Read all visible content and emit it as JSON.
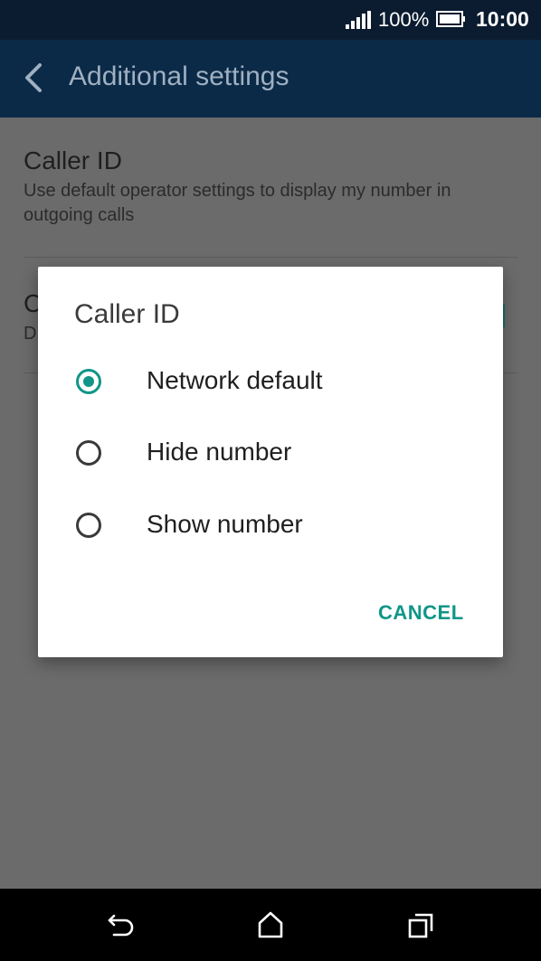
{
  "status_bar": {
    "battery_percent": "100%",
    "time": "10:00"
  },
  "app_bar": {
    "title": "Additional settings",
    "back_icon": "chevron-left-icon"
  },
  "settings": [
    {
      "title": "Caller ID",
      "summary": "Use default operator settings to display my number in outgoing calls"
    },
    {
      "title": "C",
      "summary": "D"
    }
  ],
  "dialog": {
    "title": "Caller ID",
    "options": [
      {
        "label": "Network default",
        "selected": true
      },
      {
        "label": "Hide number",
        "selected": false
      },
      {
        "label": "Show number",
        "selected": false
      }
    ],
    "cancel_label": "CANCEL"
  },
  "colors": {
    "accent": "#0f9688",
    "app_bar": "#0b2a48",
    "status_bar": "#0b1c30"
  },
  "nav_bar": {
    "icons": [
      "back-icon",
      "home-icon",
      "recents-icon"
    ]
  }
}
